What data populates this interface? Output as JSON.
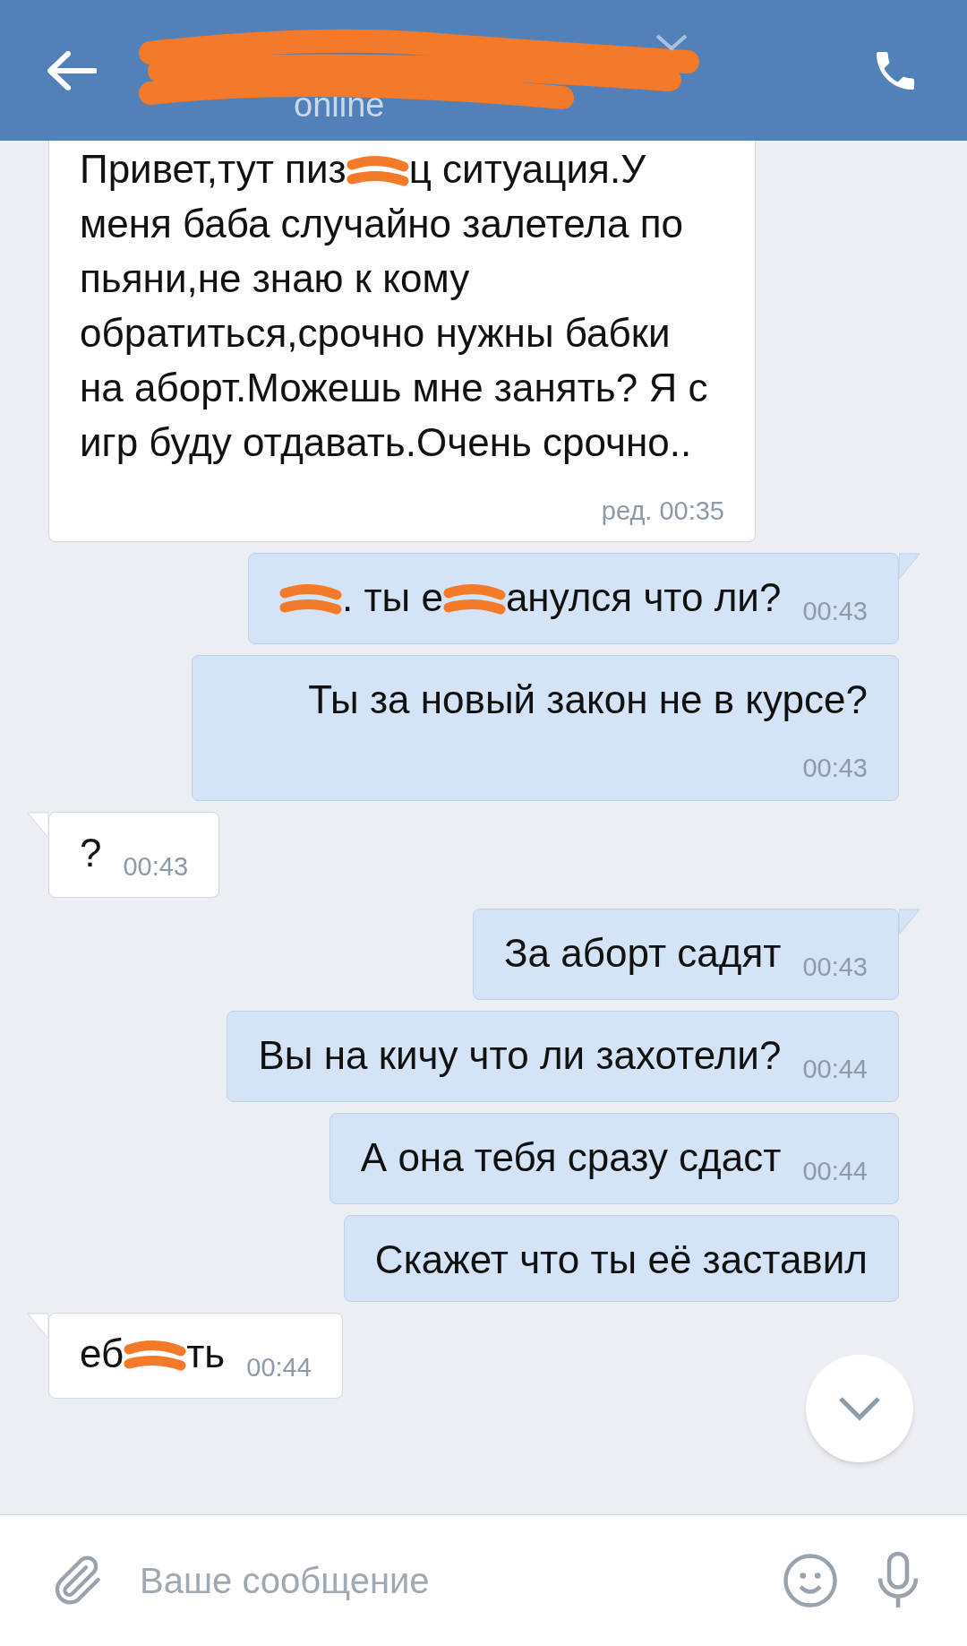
{
  "header": {
    "status": "online"
  },
  "messages": [
    {
      "kind": "incoming",
      "tail": false,
      "parts": [
        {
          "kind": "text",
          "text": "Привет,тут пиз"
        },
        {
          "kind": "redaction"
        },
        {
          "kind": "text",
          "text": "ц ситуация.У меня баба случайно залетела по пьяни,не знаю к кому обратиться,срочно нужны бабки на аборт.Можешь мне занять? Я с игр буду отдавать.Очень срочно.."
        }
      ],
      "time": "ред. 00:35"
    },
    {
      "kind": "outgoing",
      "tail": true,
      "parts": [
        {
          "kind": "redaction"
        },
        {
          "kind": "text",
          "text": ". ты е"
        },
        {
          "kind": "redaction"
        },
        {
          "kind": "text",
          "text": "анулся что ли?"
        }
      ],
      "time": "00:43"
    },
    {
      "kind": "outgoing",
      "tail": false,
      "parts": [
        {
          "kind": "text",
          "text": "Ты за новый закон не в курсе?"
        }
      ],
      "time": "00:43"
    },
    {
      "kind": "incoming",
      "tail": true,
      "parts": [
        {
          "kind": "text",
          "text": "?"
        }
      ],
      "time": "00:43"
    },
    {
      "kind": "outgoing",
      "tail": true,
      "parts": [
        {
          "kind": "text",
          "text": "За аборт садят"
        }
      ],
      "time": "00:43"
    },
    {
      "kind": "outgoing",
      "tail": false,
      "parts": [
        {
          "kind": "text",
          "text": "Вы на кичу что ли захотели?"
        }
      ],
      "time": "00:44"
    },
    {
      "kind": "outgoing",
      "tail": false,
      "parts": [
        {
          "kind": "text",
          "text": "А она тебя сразу сдаст"
        }
      ],
      "time": "00:44"
    },
    {
      "kind": "outgoing",
      "tail": false,
      "parts": [
        {
          "kind": "text",
          "text": "Скажет что ты её заставил"
        }
      ]
    },
    {
      "kind": "incoming",
      "tail": true,
      "parts": [
        {
          "kind": "text",
          "text": "еб"
        },
        {
          "kind": "redaction"
        },
        {
          "kind": "text",
          "text": "ть"
        }
      ],
      "time": "00:44"
    }
  ],
  "composer": {
    "placeholder": "Ваше сообщение"
  }
}
